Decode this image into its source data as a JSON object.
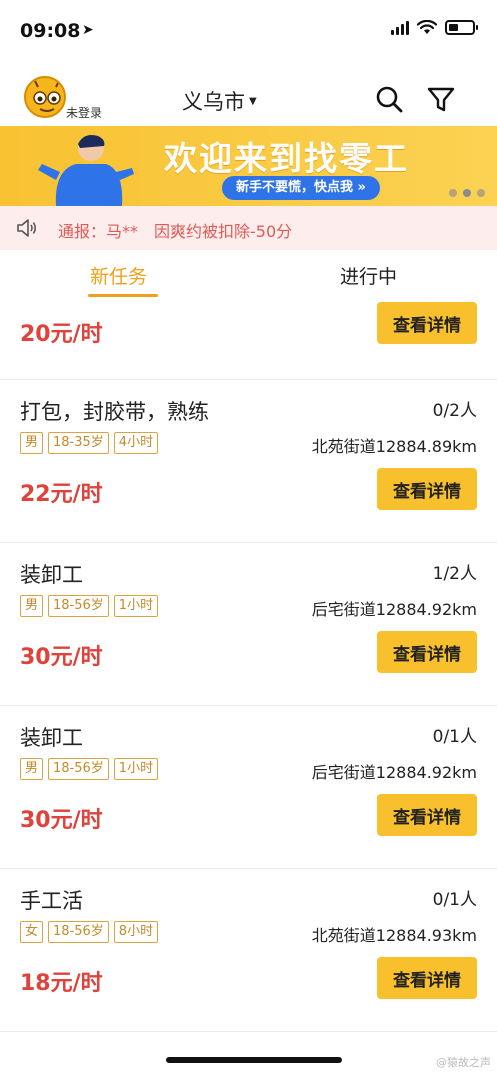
{
  "status": {
    "time": "09:08"
  },
  "header": {
    "login_label": "未登录",
    "city": "义乌市"
  },
  "banner": {
    "title": "欢迎来到找零工",
    "button": "新手不要慌，快点我 »"
  },
  "notice": {
    "text": "通报：马**　因爽约被扣除-50分"
  },
  "tabs": [
    {
      "label": "新任务",
      "active": true
    },
    {
      "label": "进行中",
      "active": false
    }
  ],
  "partial_job": {
    "pay": "20元/时",
    "button": "查看详情"
  },
  "jobs": [
    {
      "title": "打包，封胶带，熟练",
      "count": "0/2人",
      "tags": [
        "男",
        "18-35岁",
        "4小时"
      ],
      "location": "北苑街道12884.89km",
      "pay": "22元/时",
      "button": "查看详情"
    },
    {
      "title": "装卸工",
      "count": "1/2人",
      "tags": [
        "男",
        "18-56岁",
        "1小时"
      ],
      "location": "后宅街道12884.92km",
      "pay": "30元/时",
      "button": "查看详情"
    },
    {
      "title": "装卸工",
      "count": "0/1人",
      "tags": [
        "男",
        "18-56岁",
        "1小时"
      ],
      "location": "后宅街道12884.92km",
      "pay": "30元/时",
      "button": "查看详情"
    },
    {
      "title": "手工活",
      "count": "0/1人",
      "tags": [
        "女",
        "18-56岁",
        "8小时"
      ],
      "location": "北苑街道12884.93km",
      "pay": "18元/时",
      "button": "查看详情"
    }
  ],
  "watermark": "@猿故之声",
  "colors": {
    "accent": "#f0a11a",
    "button": "#f8c02d",
    "pay": "#e0413a",
    "notice_bg": "#fdeeed"
  },
  "icons": [
    "location-arrow-icon",
    "signal-icon",
    "wifi-icon",
    "battery-icon",
    "avatar-icon",
    "search-icon",
    "filter-icon",
    "speaker-icon"
  ]
}
